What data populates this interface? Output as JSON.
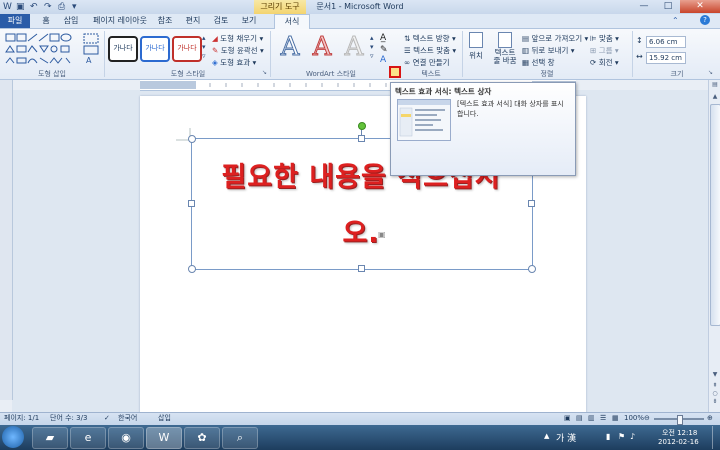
{
  "title": "문서1 - Microsoft Word",
  "contextual_tab": "그리기 도구",
  "tabs": [
    "파일",
    "홈",
    "삽입",
    "페이지 레이아웃",
    "참조",
    "편지",
    "검토",
    "보기",
    "서식"
  ],
  "ribbon": {
    "groups": {
      "insert_shapes": "도형 삽입",
      "shape_styles": "도형 스타일",
      "wordart_styles": "WordArt 스타일",
      "text": "텍스트",
      "arrange": "정렬",
      "size": "크기"
    },
    "style_sample": "가나다",
    "shape_fill": "도형 채우기",
    "shape_outline": "도형 윤곽선",
    "shape_effects": "도형 효과",
    "text_direction": "텍스트 방향",
    "text_align": "텍스트 맞춤",
    "create_link": "연결 만들기",
    "position": "위치",
    "wrap_text": "텍스트\n줄 바꿈",
    "bring_forward": "앞으로 가져오기",
    "send_backward": "뒤로 보내기",
    "selection_pane": "선택 창",
    "align": "맞춤",
    "group": "그룹",
    "rotate": "회전",
    "height": "6.06 cm",
    "width": "15.92 cm"
  },
  "document": {
    "line1": "필요한 내용을 적으십시",
    "line2": "오."
  },
  "tooltip": {
    "title": "텍스트 효과 서식: 텍스트 상자",
    "description": "[텍스트 효과 서식] 대화 상자를 표시합니다."
  },
  "status": {
    "page": "페이지: 1/1",
    "words": "단어 수: 3/3",
    "language": "한국어",
    "mode": "삽입",
    "zoom": "100%"
  },
  "tray": {
    "ime": "가 漢",
    "time": "오전 12:18",
    "date": "2012-02-16"
  }
}
